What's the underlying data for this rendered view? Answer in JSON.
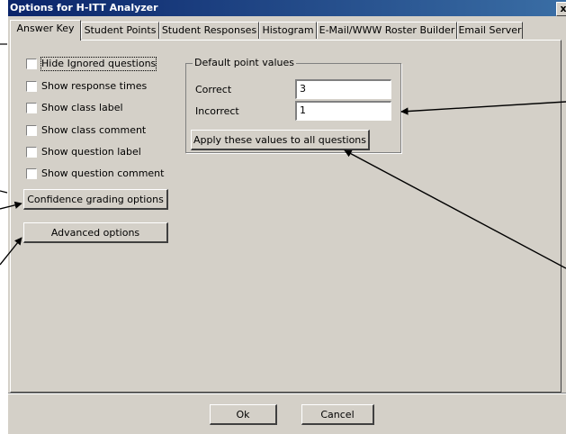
{
  "window": {
    "title": "Options for H-ITT Analyzer",
    "close_glyph": "x"
  },
  "tabs": [
    {
      "label": "Answer Key",
      "active": true
    },
    {
      "label": "Student Points"
    },
    {
      "label": "Student Responses"
    },
    {
      "label": "Histogram"
    },
    {
      "label": "E-Mail/WWW Roster Builder"
    },
    {
      "label": "Email Server"
    }
  ],
  "checkboxes": [
    {
      "label": "Hide Ignored questions",
      "checked": false
    },
    {
      "label": "Show response times",
      "checked": false
    },
    {
      "label": "Show class label",
      "checked": false
    },
    {
      "label": "Show class comment",
      "checked": false
    },
    {
      "label": "Show question label",
      "checked": false
    },
    {
      "label": "Show question comment",
      "checked": false
    }
  ],
  "buttons": {
    "confidence": "Confidence grading options",
    "advanced": "Advanced options",
    "apply": "Apply these values to all questions",
    "ok": "Ok",
    "cancel": "Cancel"
  },
  "point_values": {
    "group_label": "Default point values",
    "correct_label": "Correct",
    "correct_value": "3",
    "incorrect_label": "Incorrect",
    "incorrect_value": "1"
  }
}
